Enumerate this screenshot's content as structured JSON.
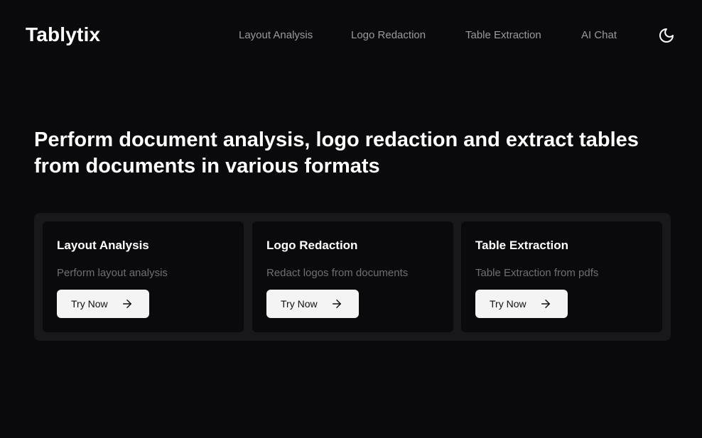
{
  "header": {
    "brand": "Tablytix",
    "nav": [
      {
        "label": "Layout Analysis"
      },
      {
        "label": "Logo Redaction"
      },
      {
        "label": "Table Extraction"
      },
      {
        "label": "AI Chat"
      }
    ],
    "theme_icon": "moon-icon"
  },
  "hero": {
    "title": "Perform document analysis, logo redaction and extract tables from documents in various formats"
  },
  "cards": [
    {
      "title": "Layout Analysis",
      "description": "Perform layout analysis",
      "button_label": "Try Now",
      "button_icon": "arrow-right-icon"
    },
    {
      "title": "Logo Redaction",
      "description": "Redact logos from documents",
      "button_label": "Try Now",
      "button_icon": "arrow-right-icon"
    },
    {
      "title": "Table Extraction",
      "description": "Table Extraction from pdfs",
      "button_label": "Try Now",
      "button_icon": "arrow-right-icon"
    }
  ],
  "colors": {
    "background": "#0a0a0c",
    "panel": "#18181b",
    "nav_text": "#9a9a9e",
    "muted_text": "#6e6e74",
    "button_bg": "#f4f4f5",
    "button_text": "#111111"
  }
}
